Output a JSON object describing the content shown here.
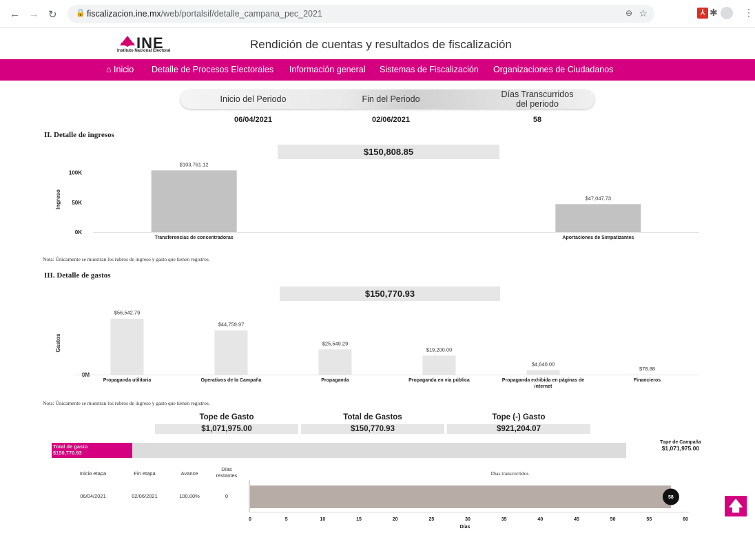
{
  "browser": {
    "url_host": "fiscalizacion.ine.mx",
    "url_path": "/web/portalsif/detalle_campana_pec_2021"
  },
  "header": {
    "logo_text": "INE",
    "logo_sub": "Instituto Nacional Electoral",
    "title": "Rendición de cuentas y resultados de fiscalización"
  },
  "nav": {
    "items": [
      "Inicio",
      "Detalle de Procesos Electorales",
      "Información general",
      "Sistemas de Fiscalización",
      "Organizaciones de Ciudadanos"
    ]
  },
  "period": {
    "inicio_label": "Inicio del Periodo",
    "fin_label": "Fin del Periodo",
    "dias_label_1": "Días Transcurridos",
    "dias_label_2": "del periodo",
    "inicio_value": "06/04/2021",
    "fin_value": "02/06/2021",
    "dias_value": "58"
  },
  "ingresos": {
    "title": "II. Detalle de ingresos",
    "total": "$150,808.85",
    "note": "Nota: Únicamente se muestran los rubros de ingreso y gasto que tienen registros."
  },
  "gastos": {
    "title": "III. Detalle de gastos",
    "total": "$150,770.93",
    "note": "Nota: Únicamente se muestran los rubros de ingreso y gasto que tienen registros."
  },
  "chart_data": [
    {
      "type": "bar",
      "ylabel": "Ingreso",
      "ylim": [
        0,
        110000
      ],
      "yticks": [
        {
          "v": 0,
          "l": "0K"
        },
        {
          "v": 50000,
          "l": "50K"
        },
        {
          "v": 100000,
          "l": "100K"
        }
      ],
      "categories": [
        "Transferencias de concentradoras",
        "",
        "Aportaciones de Simpatizantes"
      ],
      "values": [
        103761.12,
        0,
        47047.73
      ],
      "value_labels": [
        "$103,761.12",
        "",
        "$47,047.73"
      ],
      "color": "#c2c2c2"
    },
    {
      "type": "bar",
      "ylabel": "Gastos",
      "ylim": [
        0,
        64000
      ],
      "yticks": [
        {
          "v": 0,
          "l": "0M"
        }
      ],
      "categories": [
        "Propaganda utilitaria",
        "Operativos de la Campaña",
        "Propaganda",
        "Propaganda en vía pública",
        "Propaganda exhibida en páginas de internet",
        "Financieros"
      ],
      "values": [
        56542.79,
        44759.97,
        25549.29,
        19200.0,
        4640.0,
        78.88
      ],
      "value_labels": [
        "$56,542.79",
        "$44,759.97",
        "$25,549.29",
        "$19,200.00",
        "$4,640.00",
        "$78.88"
      ],
      "color": "#e6e6e6"
    }
  ],
  "summary": {
    "tope_label": "Tope de Gasto",
    "tope_value": "$1,071,975.00",
    "total_label": "Total de Gastos",
    "total_value": "$150,770.93",
    "diff_label": "Tope (-) Gasto",
    "diff_value": "$921,204.07"
  },
  "progress": {
    "label_1": "Total de gasto",
    "label_2": "$150,770.93",
    "fraction": 0.1406,
    "tope_label": "Tope de Campaña",
    "tope_value": "$1,071,975.00"
  },
  "etapas": {
    "headers": [
      "Inicio etapa",
      "Fin etapa",
      "Avance",
      "Días restantes"
    ],
    "chart_title": "Días transcurridos",
    "row": [
      "06/04/2021",
      "02/06/2021",
      "100.00%",
      "0"
    ],
    "days_value": 58,
    "days_label": "58",
    "xticks": [
      0,
      5,
      10,
      15,
      20,
      25,
      30,
      35,
      40,
      45,
      50,
      55,
      60
    ],
    "xlabel": "Días"
  }
}
